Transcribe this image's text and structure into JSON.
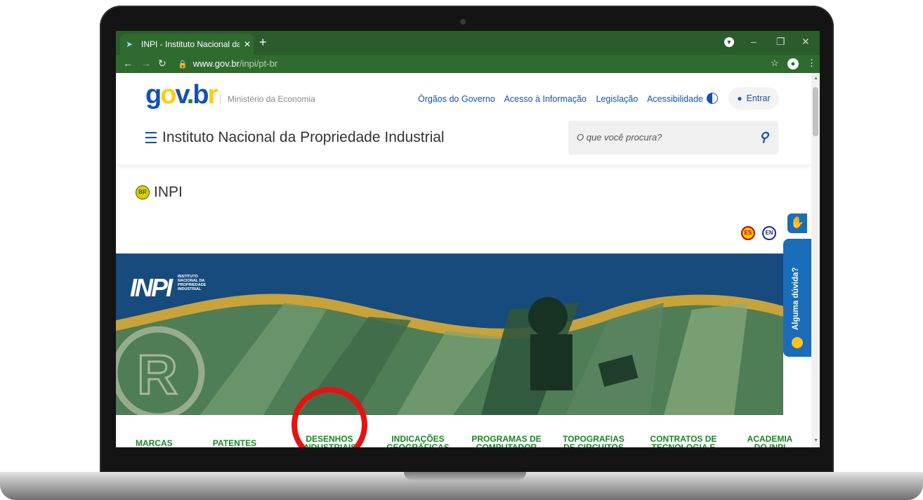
{
  "browser": {
    "tab_title": "INPI - Instituto Nacional da Propr",
    "url_host": "www.gov.br",
    "url_path": "/inpi/pt-br"
  },
  "header": {
    "logo_text": "gov.br",
    "ministry": "Ministério da Economia",
    "links": [
      "Órgãos do Governo",
      "Acesso à Informação",
      "Legislação",
      "Acessibilidade"
    ],
    "login_label": "Entrar",
    "site_title": "Instituto Nacional da Propriedade Industrial",
    "search_placeholder": "O que você procura?"
  },
  "breadcrumb": {
    "flag": "BR",
    "label": "INPI"
  },
  "languages": [
    "ES",
    "EN"
  ],
  "help_tab": "Alguma dúvida?",
  "banner": {
    "logo": "INPI",
    "logo_subtitle": [
      "INSTITUTO",
      "NACIONAL DA",
      "PROPRIEDADE",
      "INDUSTRIAL"
    ]
  },
  "categories": [
    "MARCAS",
    "PATENTES",
    "DESENHOS\nINDUSTRIAIS",
    "INDICAÇÕES\nGEOGRÁFICAS",
    "PROGRAMAS DE\nCOMPUTADOR",
    "TOPOGRAFIAS\nDE CIRCUITOS\nINTEGRADOS",
    "CONTRATOS DE\nTECNOLOGIA E\nDE FRANQUIA",
    "ACADEMIA\nDO INPI"
  ],
  "colors": {
    "gov_blue": "#1351b4",
    "category_green": "#168821",
    "chrome_green": "#2f6b2f",
    "highlight_red": "#e41313",
    "banner_blue": "#174a7d"
  }
}
